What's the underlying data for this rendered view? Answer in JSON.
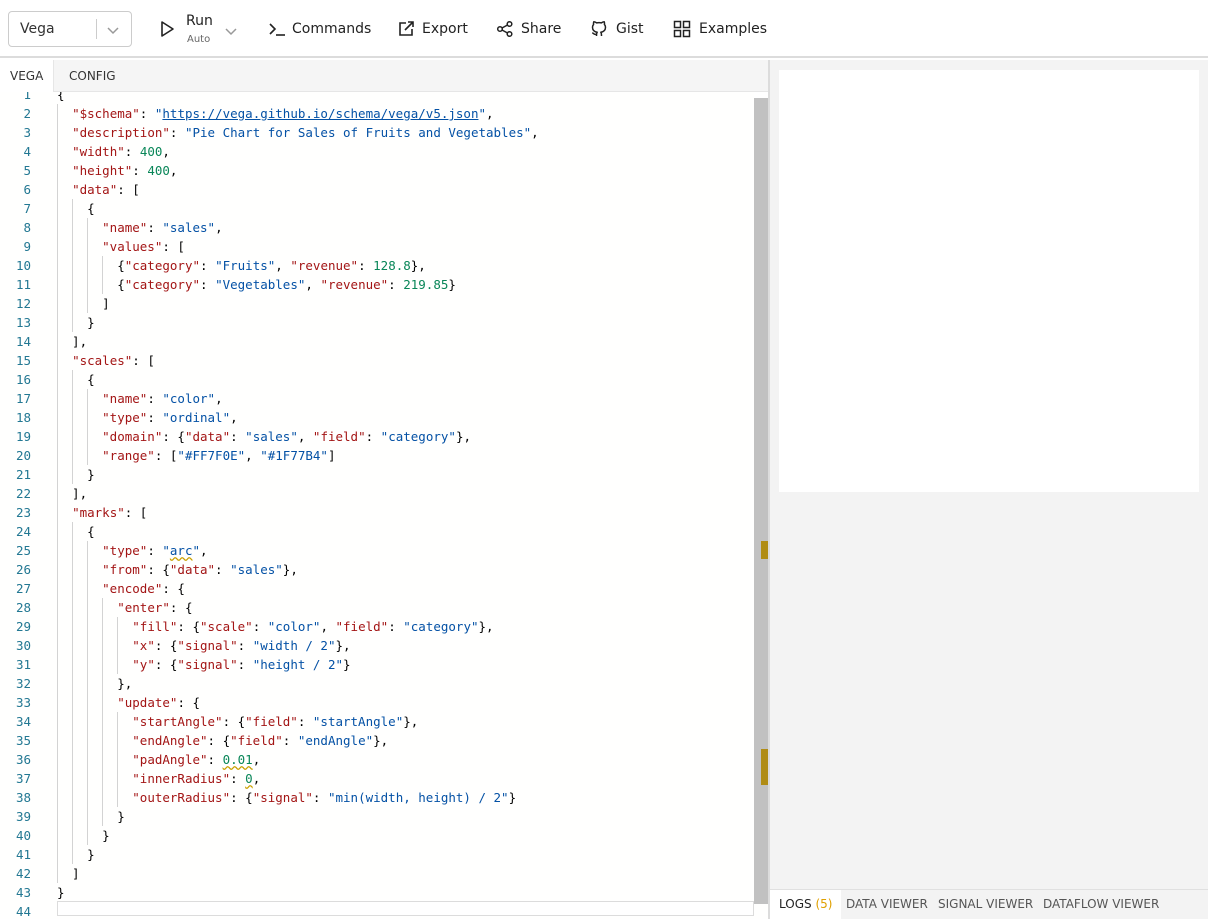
{
  "toolbar": {
    "mode": "Vega",
    "run_label": "Run",
    "run_sub": "Auto",
    "commands": "Commands",
    "export": "Export",
    "share": "Share",
    "gist": "Gist",
    "examples": "Examples"
  },
  "editor_tabs": [
    "VEGA",
    "CONFIG"
  ],
  "bottom_tabs": {
    "logs": "LOGS",
    "logs_count": "(5)",
    "data_viewer": "DATA VIEWER",
    "signal_viewer": "SIGNAL VIEWER",
    "dataflow_viewer": "DATAFLOW VIEWER"
  },
  "code_lines": [
    "{",
    "  \"$schema\": \"https://vega.github.io/schema/vega/v5.json\",",
    "  \"description\": \"Pie Chart for Sales of Fruits and Vegetables\",",
    "  \"width\": 400,",
    "  \"height\": 400,",
    "  \"data\": [",
    "    {",
    "      \"name\": \"sales\",",
    "      \"values\": [",
    "        {\"category\": \"Fruits\", \"revenue\": 128.8},",
    "        {\"category\": \"Vegetables\", \"revenue\": 219.85}",
    "      ]",
    "    }",
    "  ],",
    "  \"scales\": [",
    "    {",
    "      \"name\": \"color\",",
    "      \"type\": \"ordinal\",",
    "      \"domain\": {\"data\": \"sales\", \"field\": \"category\"},",
    "      \"range\": [\"#FF7F0E\", \"#1F77B4\"]",
    "    }",
    "  ],",
    "  \"marks\": [",
    "    {",
    "      \"type\": \"arc\",",
    "      \"from\": {\"data\": \"sales\"},",
    "      \"encode\": {",
    "        \"enter\": {",
    "          \"fill\": {\"scale\": \"color\", \"field\": \"category\"},",
    "          \"x\": {\"signal\": \"width / 2\"},",
    "          \"y\": {\"signal\": \"height / 2\"}",
    "        },",
    "        \"update\": {",
    "          \"startAngle\": {\"field\": \"startAngle\"},",
    "          \"endAngle\": {\"field\": \"endAngle\"},",
    "          \"padAngle\": 0.01,",
    "          \"innerRadius\": 0,",
    "          \"outerRadius\": {\"signal\": \"min(width, height) / 2\"}",
    "        }",
    "      }",
    "    }",
    "  ]",
    "}",
    ""
  ],
  "colors": {
    "key": "#a31515",
    "string": "#0451a5",
    "number": "#098658",
    "line_number": "#237893",
    "warning_marker": "#b08c14"
  }
}
